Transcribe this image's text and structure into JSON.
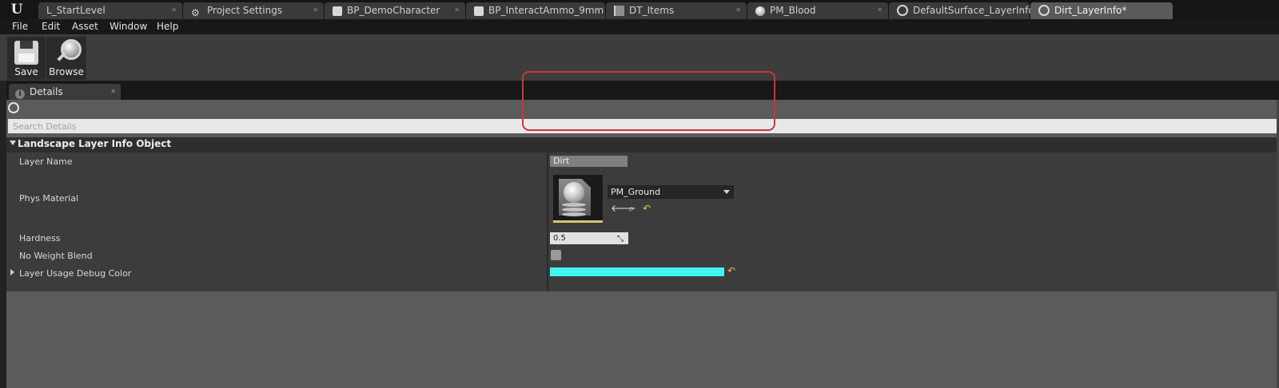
{
  "tabs": [
    {
      "label": "L_StartLevel",
      "icon": "ue-logo-icon",
      "active": false
    },
    {
      "label": "Project Settings",
      "icon": "gear-icon",
      "active": false
    },
    {
      "label": "BP_DemoCharacter",
      "icon": "blueprint-icon",
      "active": false
    },
    {
      "label": "BP_InteractAmmo_9mm",
      "icon": "blueprint-icon",
      "active": false
    },
    {
      "label": "DT_Items",
      "icon": "data-table-icon",
      "active": false
    },
    {
      "label": "PM_Blood",
      "icon": "physical-material-icon",
      "active": false
    },
    {
      "label": "DefaultSurface_LayerInfo",
      "icon": "layer-info-icon",
      "active": false
    },
    {
      "label": "Dirt_LayerInfo*",
      "icon": "layer-info-icon",
      "active": true
    }
  ],
  "menu": [
    "File",
    "Edit",
    "Asset",
    "Window",
    "Help"
  ],
  "toolbar": {
    "save_label": "Save",
    "browse_label": "Browse"
  },
  "details": {
    "tab_label": "Details",
    "search_placeholder": "Search Details",
    "category": "Landscape Layer Info Object",
    "props": {
      "layer_name": {
        "label": "Layer Name",
        "value": "Dirt"
      },
      "phys_material": {
        "label": "Phys Material",
        "value": "PM_Ground"
      },
      "hardness": {
        "label": "Hardness",
        "value": "0.5"
      },
      "no_weight_blend": {
        "label": "No Weight Blend",
        "checked": false
      },
      "debug_color": {
        "label": "Layer Usage Debug Color",
        "color": "#40f6f2"
      }
    }
  },
  "colors": {
    "highlight": "#d0343b",
    "reset_arrow": "#e6c53a",
    "thumbnail_border": "#d7c66e"
  }
}
